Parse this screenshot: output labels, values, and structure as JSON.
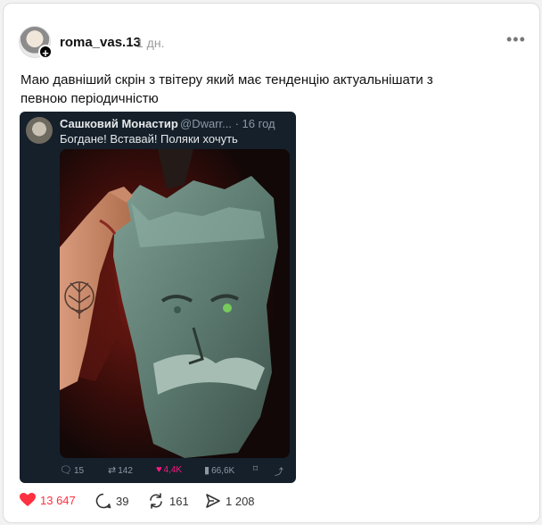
{
  "post": {
    "username": "roma_vas.13",
    "time": "1 дн.",
    "more": "•••",
    "avatar_plus": "+",
    "text": "Маю давніший скрін з твітеру який має тенденцію актуальнішати з певною періодичністю"
  },
  "tweet": {
    "name": "Сашковий Монастир",
    "handle": "@Dwarr...",
    "time": "· 16 год",
    "text": "Богдане! Вставай! Поляки хочуть",
    "stats": {
      "replies": "15",
      "retweets": "142",
      "likes": "4,4K",
      "views": "66,6K"
    }
  },
  "actions": {
    "likes": "13 647",
    "comments": "39",
    "reposts": "161",
    "shares": "1 208"
  },
  "colors": {
    "like": "#ff3040",
    "tweet_bg": "#15202b",
    "tweet_like": "#f91880"
  }
}
